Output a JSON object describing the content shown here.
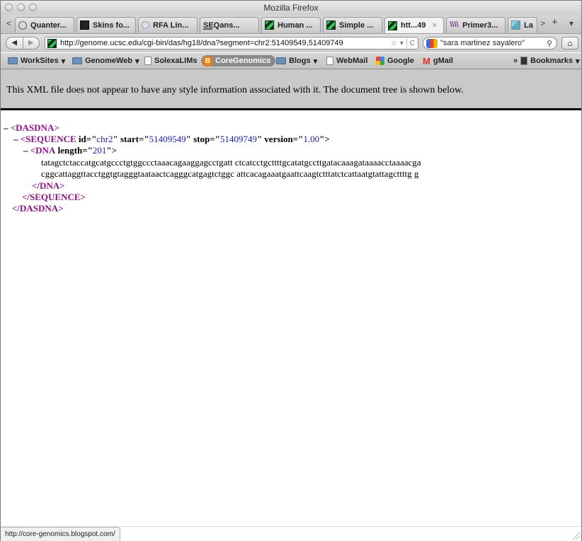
{
  "window": {
    "title": "Mozilla Firefox"
  },
  "tabs": [
    {
      "label": "Quanter...",
      "icon": "search-circle-icon"
    },
    {
      "label": "Skins fo...",
      "icon": "skins-icon"
    },
    {
      "label": "RFA Lin...",
      "icon": "rfa-icon"
    },
    {
      "label": "SEQans...",
      "icon": "seqanswers-icon"
    },
    {
      "label": "Human ...",
      "icon": "ucsc-icon"
    },
    {
      "label": "Simple ...",
      "icon": "ucsc-icon"
    },
    {
      "label": "htt...49",
      "icon": "ucsc-icon",
      "active": true
    },
    {
      "label": "Primer3...",
      "icon": "primer3-icon"
    },
    {
      "label": "La",
      "icon": "la-icon"
    }
  ],
  "tabbar": {
    "back_arrow": "<",
    "more_arrow": ">",
    "new_tab": "+",
    "list_tabs": "▾"
  },
  "nav": {
    "back": "◀",
    "forward": "▶",
    "url": "http://genome.ucsc.edu/cgi-bin/das/hg18/dna?segment=chr2:51409549,51409749",
    "star": "☆",
    "dropdown": "▾",
    "reload": "C",
    "search_text": "\"sara martinez sayalero\"",
    "search_icon": "🔍",
    "home": "⌂"
  },
  "bookmarks": [
    {
      "label": "WorkSites",
      "type": "folder",
      "dropdown": true
    },
    {
      "label": "GenomeWeb",
      "type": "folder",
      "dropdown": true
    },
    {
      "label": "SolexaLIMs",
      "type": "page"
    },
    {
      "label": "CoreGenomics",
      "type": "blogger",
      "highlighted": true
    },
    {
      "label": "Blogs",
      "type": "folder",
      "dropdown": true
    },
    {
      "label": "WebMail",
      "type": "page"
    },
    {
      "label": "Google",
      "type": "google"
    },
    {
      "label": "gMail",
      "type": "gmail"
    }
  ],
  "bookmarks_menu": {
    "overflow": "»",
    "label": "Bookmarks"
  },
  "xml_notice": "This XML file does not appear to have any style information associated with it. The document tree is shown below.",
  "xml": {
    "collapse": "–",
    "root_open": "<DASDNA>",
    "root_close": "</DASDNA>",
    "sequence": {
      "tag": "<SEQUENCE",
      "attrs": [
        {
          "name": "id",
          "value": "chr2"
        },
        {
          "name": "start",
          "value": "51409549"
        },
        {
          "name": "stop",
          "value": "51409749"
        },
        {
          "name": "version",
          "value": "1.00"
        }
      ],
      "close": "</SEQUENCE>"
    },
    "dna": {
      "tag": "<DNA",
      "attr_name": "length",
      "attr_value": "201",
      "close": "</DNA>",
      "lines": [
        "tatagctctaccatgcatgccctgtggccctaaacagaaggagcctgatt ctcatcctgcttttgcatatgccttgatacaaagataaaacctaaaacga",
        "cggcattaggttacctggtgtagggtaataactcagggcatgagtctggc attcacagaaatgaattcaagtctttatctcattaatgtattagcttttg g"
      ]
    }
  },
  "status": {
    "text": "http://core-genomics.blogspot.com/"
  }
}
